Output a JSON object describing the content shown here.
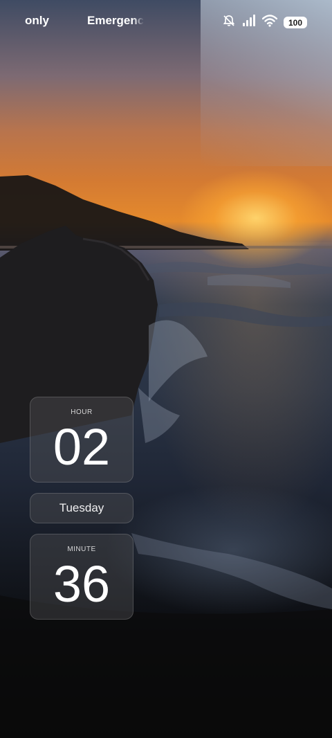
{
  "status_bar": {
    "carrier_left": "only",
    "carrier_right": "Emergenc",
    "icons": [
      "bell-muted-icon",
      "signal-icon",
      "wifi-icon"
    ],
    "battery_level": "100"
  },
  "clock_widget": {
    "hour_label": "HOUR",
    "hour_value": "02",
    "day": "Tuesday",
    "minute_label": "MINUTE",
    "minute_value": "36"
  },
  "colors": {
    "widget_bg": "#505054",
    "text": "#ffffff",
    "sunset_orange": "#e58a2c"
  }
}
